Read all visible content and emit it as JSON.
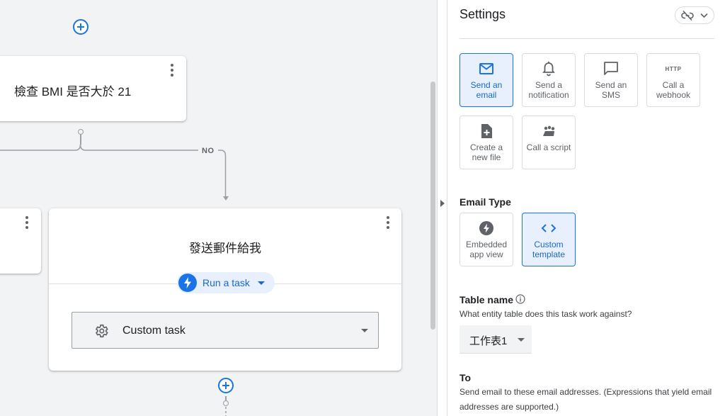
{
  "canvas": {
    "condition_node": {
      "title": "檢查 BMI 是否大於 21"
    },
    "branch_label": "NO",
    "action_node": {
      "title": "發送郵件給我",
      "run_chip_label": "Run a task",
      "task_select_value": "Custom task"
    }
  },
  "settings": {
    "title": "Settings",
    "action_tiles": [
      {
        "label": "Send an email",
        "icon": "email-icon",
        "selected": true
      },
      {
        "label": "Send a notification",
        "icon": "bell-icon",
        "selected": false
      },
      {
        "label": "Send an SMS",
        "icon": "sms-icon",
        "selected": false
      },
      {
        "label": "Call a webhook",
        "icon": "http-icon",
        "icon_text": "HTTP",
        "selected": false
      },
      {
        "label": "Create a new file",
        "icon": "new-file-icon",
        "selected": false
      },
      {
        "label": "Call a script",
        "icon": "script-icon",
        "selected": false
      }
    ],
    "email_type": {
      "label": "Email Type",
      "options": [
        {
          "label": "Embedded app view",
          "icon": "bolt-icon",
          "selected": false
        },
        {
          "label": "Custom template",
          "icon": "code-icon",
          "selected": true
        }
      ]
    },
    "table": {
      "label": "Table name",
      "help": "What entity table does this task work against?",
      "value": "工作表1"
    },
    "to": {
      "label": "To",
      "help": "Send email to these email addresses. (Expressions that yield email addresses are supported.)"
    }
  },
  "colors": {
    "accent": "#1a73e8",
    "accent_bg": "#e8f0fe",
    "canvas_bg": "#f1f3f4"
  }
}
